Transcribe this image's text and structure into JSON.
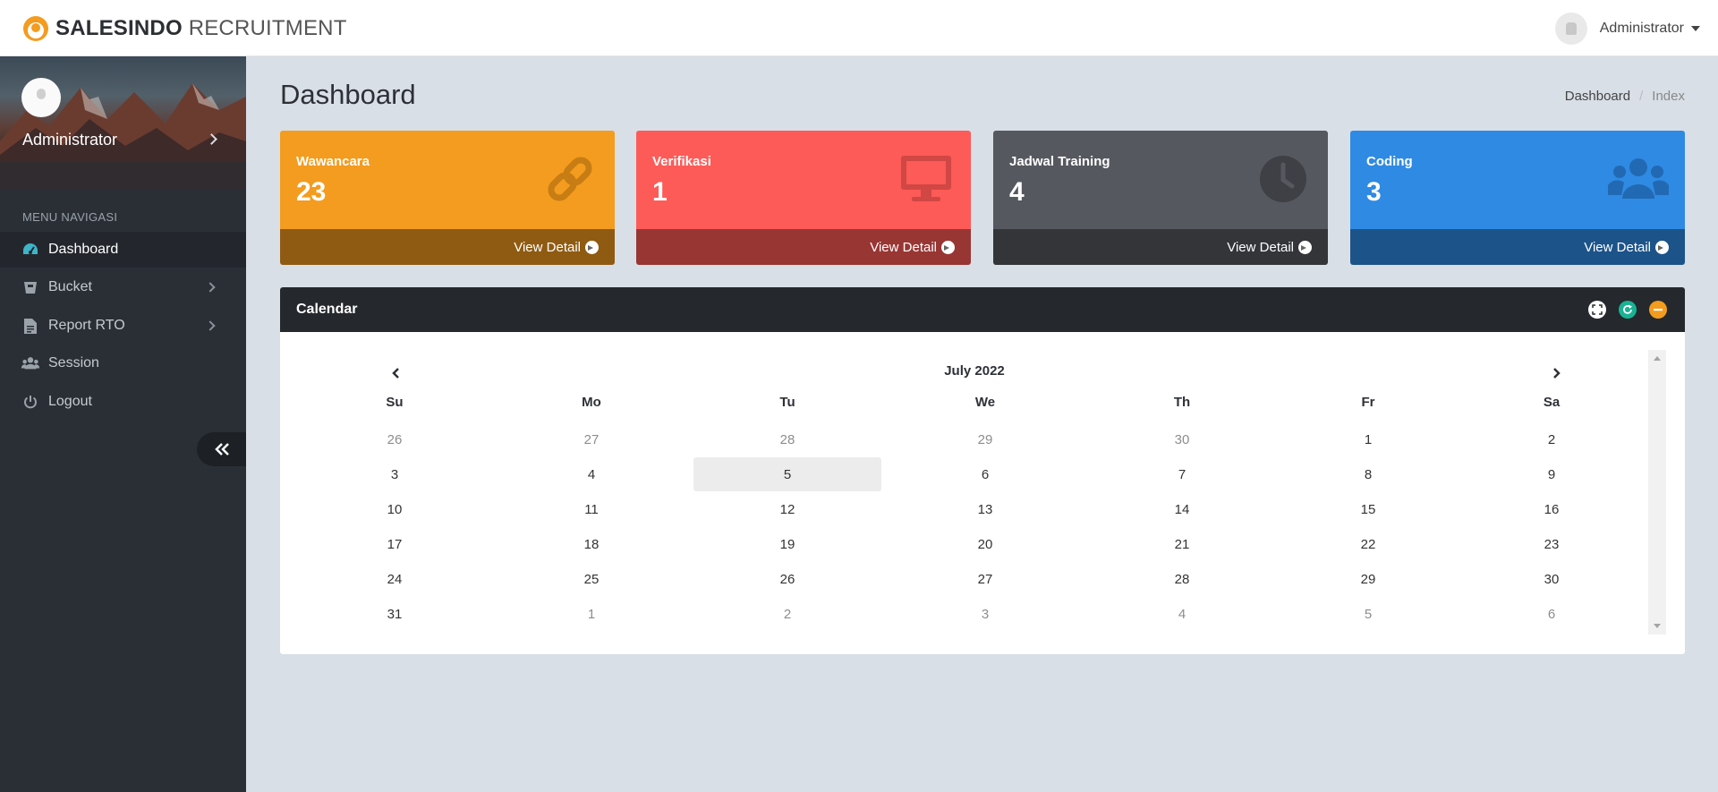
{
  "brand": {
    "bold": "SALESINDO",
    "light": " RECRUITMENT"
  },
  "topbar": {
    "user_name": "Administrator"
  },
  "sidebar": {
    "profile_name": "Administrator",
    "menu_header": "MENU NAVIGASI",
    "items": [
      {
        "label": "Dashboard",
        "icon": "dashboard-icon",
        "active": true
      },
      {
        "label": "Bucket",
        "icon": "bucket-icon",
        "has_submenu": true
      },
      {
        "label": "Report RTO",
        "icon": "report-icon",
        "has_submenu": true
      },
      {
        "label": "Session",
        "icon": "users-icon"
      },
      {
        "label": "Logout",
        "icon": "power-icon"
      }
    ]
  },
  "page": {
    "title": "Dashboard"
  },
  "breadcrumb": {
    "home": "Dashboard",
    "current": "Index"
  },
  "cards": [
    {
      "title": "Wawancara",
      "value": "23",
      "link": "View Detail",
      "icon": "link-icon",
      "color": "#f39c1f",
      "foot_color": "#8f5b12"
    },
    {
      "title": "Verifikasi",
      "value": "1",
      "link": "View Detail",
      "icon": "monitor-icon",
      "color": "#fd5b58",
      "foot_color": "#983634"
    },
    {
      "title": "Jadwal Training",
      "value": "4",
      "link": "View Detail",
      "icon": "clock-icon",
      "color": "#55585e",
      "foot_color": "#333538"
    },
    {
      "title": "Coding",
      "value": "3",
      "link": "View Detail",
      "icon": "users-icon",
      "color": "#2f8ae3",
      "foot_color": "#1c5389"
    }
  ],
  "calendar": {
    "panel_title": "Calendar",
    "month_label": "July 2022",
    "days_of_week": [
      "Su",
      "Mo",
      "Tu",
      "We",
      "Th",
      "Fr",
      "Sa"
    ],
    "weeks": [
      [
        "26",
        "27",
        "28",
        "29",
        "30",
        "1",
        "2"
      ],
      [
        "3",
        "4",
        "5",
        "6",
        "7",
        "8",
        "9"
      ],
      [
        "10",
        "11",
        "12",
        "13",
        "14",
        "15",
        "16"
      ],
      [
        "17",
        "18",
        "19",
        "20",
        "21",
        "22",
        "23"
      ],
      [
        "24",
        "25",
        "26",
        "27",
        "28",
        "29",
        "30"
      ],
      [
        "31",
        "1",
        "2",
        "3",
        "4",
        "5",
        "6"
      ]
    ],
    "muted": [
      [
        true,
        true,
        true,
        true,
        true,
        false,
        false
      ],
      [
        false,
        false,
        false,
        false,
        false,
        false,
        false
      ],
      [
        false,
        false,
        false,
        false,
        false,
        false,
        false
      ],
      [
        false,
        false,
        false,
        false,
        false,
        false,
        false
      ],
      [
        false,
        false,
        false,
        false,
        false,
        false,
        false
      ],
      [
        false,
        true,
        true,
        true,
        true,
        true,
        true
      ]
    ],
    "selected_day": "5",
    "tools": [
      {
        "icon": "expand-icon",
        "color": "#ffffff"
      },
      {
        "icon": "refresh-icon",
        "color": "#19b394"
      },
      {
        "icon": "minus-icon",
        "color": "#f39c1f"
      }
    ]
  },
  "colors": {
    "accent": "#3fb4c8",
    "sidebar_bg": "#2a2f36",
    "page_bg": "#d9dfe7"
  }
}
